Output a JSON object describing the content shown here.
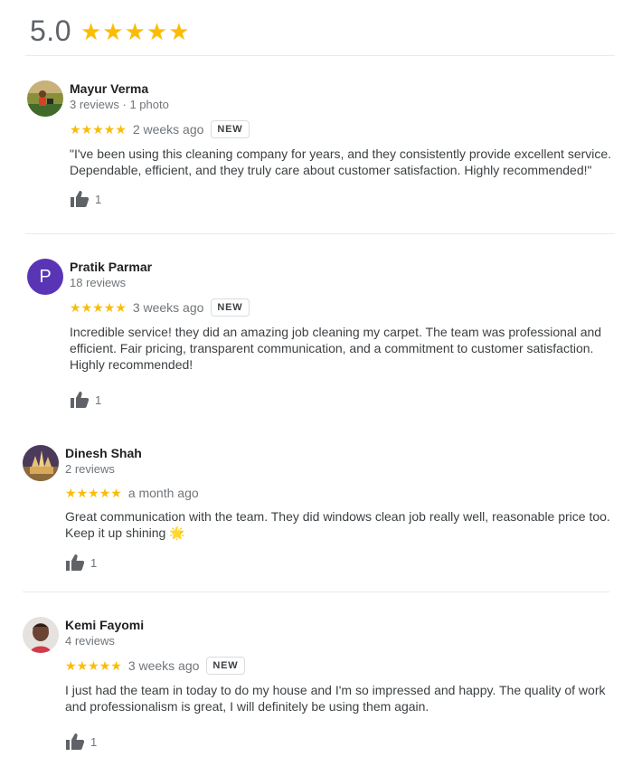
{
  "summary": {
    "rating": "5.0",
    "stars": [
      "★",
      "★",
      "★",
      "★",
      "★"
    ]
  },
  "reviews": [
    {
      "name": "Mayur Verma",
      "meta": "3 reviews · 1 photo",
      "stars": [
        "★",
        "★",
        "★",
        "★",
        "★"
      ],
      "when": "2 weeks ago",
      "badge": "NEW",
      "text": "\"I've been using this cleaning company for years, and they consistently provide excellent service. Dependable, efficient, and they truly care about customer satisfaction. Highly recommended!\"",
      "likes": "1",
      "avatar_icon": "photo-avatar"
    },
    {
      "name": "Pratik Parmar",
      "meta": "18 reviews",
      "stars": [
        "★",
        "★",
        "★",
        "★",
        "★"
      ],
      "when": "3 weeks ago",
      "badge": "NEW",
      "text": "Incredible service! they did an amazing job cleaning my carpet. The team was professional and efficient. Fair pricing, transparent communication, and a commitment to customer satisfaction. Highly recommended!",
      "likes": "1",
      "avatar_letter": "P"
    },
    {
      "name": "Dinesh Shah",
      "meta": "2 reviews",
      "stars": [
        "★",
        "★",
        "★",
        "★",
        "★"
      ],
      "when": "a month ago",
      "text": "Great communication with the team. They did windows clean job really well, reasonable price too. Keep it up shining 🌟",
      "likes": "1",
      "avatar_icon": "photo-avatar"
    },
    {
      "name": "Kemi Fayomi",
      "meta": "4 reviews",
      "stars": [
        "★",
        "★",
        "★",
        "★",
        "★"
      ],
      "when": "3 weeks ago",
      "badge": "NEW",
      "text": "I just had the team in today to do my house and I'm so impressed and happy. The quality of work and professionalism is great, I will definitely be using them again.",
      "likes": "1",
      "avatar_icon": "photo-avatar"
    }
  ],
  "colors": {
    "star": "#fbbc04",
    "avatar_letter_bg": "#5935b6"
  }
}
